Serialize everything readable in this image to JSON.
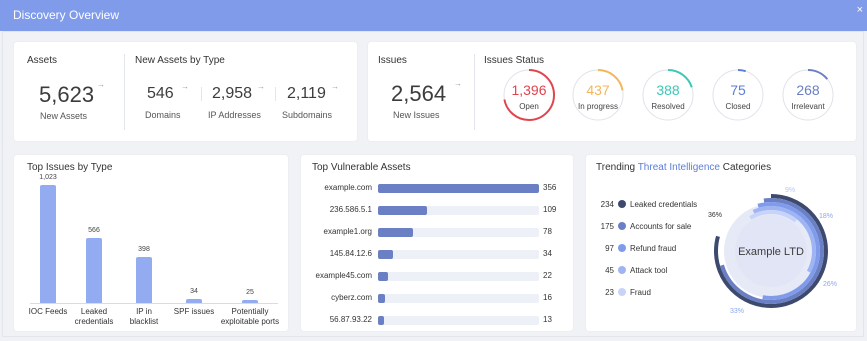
{
  "window": {
    "title": "Discovery Overview",
    "close_glyph": "×"
  },
  "assets": {
    "title": "Assets",
    "value": "5,623",
    "label": "New Assets"
  },
  "assets_by_type": {
    "title": "New Assets by Type",
    "items": [
      {
        "value": "546",
        "label": "Domains"
      },
      {
        "value": "2,958",
        "label": "IP Addresses"
      },
      {
        "value": "2,119",
        "label": "Subdomains"
      }
    ]
  },
  "issues": {
    "title": "Issues",
    "value": "2,564",
    "label": "New Issues"
  },
  "issues_status": {
    "title": "Issues Status",
    "items": [
      {
        "value": "1,396",
        "label": "Open",
        "color": "#e0454f",
        "fraction": 0.72
      },
      {
        "value": "437",
        "label": "In progress",
        "color": "#f4b65a",
        "fraction": 0.22
      },
      {
        "value": "388",
        "label": "Resolved",
        "color": "#3dc7b6",
        "fraction": 0.2
      },
      {
        "value": "75",
        "label": "Closed",
        "color": "#5b7ed6",
        "fraction": 0.05
      },
      {
        "value": "268",
        "label": "Irrelevant",
        "color": "#6b7fc4",
        "fraction": 0.14
      }
    ]
  },
  "top_issues": {
    "title": "Top Issues by Type",
    "chart_data": {
      "type": "bar",
      "categories": [
        "IOC Feeds",
        "Leaked credentials",
        "IP in blacklist",
        "SPF issues",
        "Potentially exploitable ports"
      ],
      "category_lines": [
        [
          "IOC Feeds"
        ],
        [
          "Leaked",
          "credentials"
        ],
        [
          "IP in",
          "blacklist"
        ],
        [
          "SPF issues"
        ],
        [
          "Potentially",
          "exploitable ports"
        ]
      ],
      "values": [
        1023,
        566,
        398,
        34,
        25
      ],
      "value_labels": [
        "1,023",
        "566",
        "398",
        "34",
        "25"
      ],
      "ylim": [
        0,
        1023
      ]
    }
  },
  "vulnerable_assets": {
    "title": "Top Vulnerable Assets",
    "chart_data": {
      "type": "bar",
      "orientation": "horizontal",
      "categories": [
        "example.com",
        "236.586.5.1",
        "example1.org",
        "145.84.12.6",
        "example45.com",
        "cyberz.com",
        "56.87.93.22"
      ],
      "values": [
        356,
        109,
        78,
        34,
        22,
        16,
        13
      ],
      "xlim": [
        0,
        356
      ],
      "color": "#6b7fc4"
    }
  },
  "trending": {
    "title_pre": "Trending ",
    "title_link": "Threat Intelligence",
    "title_post": " Categories",
    "center_label": "Example LTD",
    "chart_data": {
      "type": "pie",
      "labels": [
        "Leaked credentials",
        "Accounts for sale",
        "Refund fraud",
        "Attack tool",
        "Fraud"
      ],
      "values": [
        234,
        175,
        97,
        45,
        23
      ],
      "value_labels": [
        "234",
        "175",
        "97",
        "45",
        "23"
      ],
      "colors": [
        "#3d4a6e",
        "#6b7fc4",
        "#7f9bea",
        "#9fb4f3",
        "#c7d3f9"
      ],
      "ring_colors": [
        "#3d4a6e",
        "#6b7fc4",
        "#7f9bea",
        "#9fb4f3",
        "#c7d3f9"
      ],
      "percent_labels": [
        "36%",
        "33%",
        "26%",
        "18%",
        "9%"
      ],
      "percent_slices": [
        36,
        33,
        26,
        18,
        9
      ],
      "percent_colors": [
        "#333",
        "#8ea7f0",
        "#8ea7f0",
        "#8ea7f0",
        "#b9c8f6"
      ]
    }
  }
}
